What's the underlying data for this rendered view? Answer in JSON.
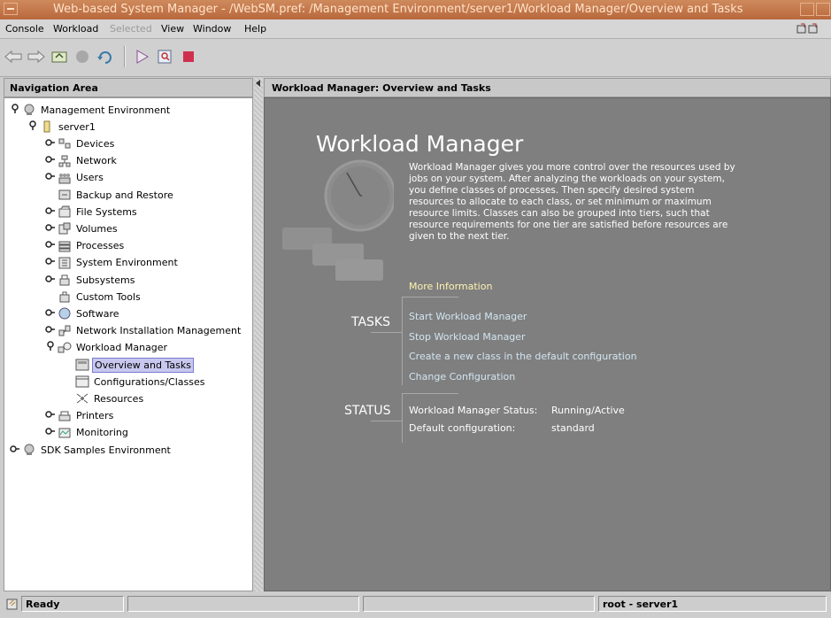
{
  "window": {
    "title": "Web-based System Manager - /WebSM.pref: /Management Environment/server1/Workload Manager/Overview and Tasks"
  },
  "menubar": {
    "console": "Console",
    "workload": "Workload",
    "selected": "Selected",
    "view": "View",
    "window": "Window",
    "help": "Help"
  },
  "toolbar": {
    "icons": [
      "back-arrow-icon",
      "forward-arrow-icon",
      "up-folder-icon",
      "stop-icon",
      "refresh-icon",
      "run-icon",
      "find-icon",
      "terminal-icon"
    ]
  },
  "navigation": {
    "header": "Navigation Area",
    "tree": [
      {
        "label": "Management Environment",
        "toggle": "open",
        "icon": "globe-icon"
      },
      {
        "label": "server1",
        "toggle": "open",
        "icon": "server-icon"
      },
      {
        "label": "Devices",
        "toggle": "closed",
        "icon": "devices-icon"
      },
      {
        "label": "Network",
        "toggle": "closed",
        "icon": "network-icon"
      },
      {
        "label": "Users",
        "toggle": "closed",
        "icon": "users-icon"
      },
      {
        "label": "Backup and Restore",
        "toggle": "",
        "icon": "backup-icon"
      },
      {
        "label": "File Systems",
        "toggle": "closed",
        "icon": "filesystem-icon"
      },
      {
        "label": "Volumes",
        "toggle": "closed",
        "icon": "volumes-icon"
      },
      {
        "label": "Processes",
        "toggle": "closed",
        "icon": "processes-icon"
      },
      {
        "label": "System Environment",
        "toggle": "closed",
        "icon": "system-env-icon"
      },
      {
        "label": "Subsystems",
        "toggle": "closed",
        "icon": "subsystems-icon"
      },
      {
        "label": "Custom Tools",
        "toggle": "",
        "icon": "custom-tools-icon"
      },
      {
        "label": "Software",
        "toggle": "closed",
        "icon": "software-icon"
      },
      {
        "label": "Network Installation Management",
        "toggle": "closed",
        "icon": "nim-icon"
      },
      {
        "label": "Workload Manager",
        "toggle": "open",
        "icon": "workload-icon"
      },
      {
        "label": "Overview and Tasks",
        "toggle": "",
        "icon": "overview-icon",
        "selected": true
      },
      {
        "label": "Configurations/Classes",
        "toggle": "",
        "icon": "configurations-icon"
      },
      {
        "label": "Resources",
        "toggle": "",
        "icon": "resources-icon"
      },
      {
        "label": "Printers",
        "toggle": "closed",
        "icon": "printer-icon"
      },
      {
        "label": "Monitoring",
        "toggle": "closed",
        "icon": "monitoring-icon"
      },
      {
        "label": "SDK Samples Environment",
        "toggle": "closed",
        "icon": "globe-icon"
      }
    ]
  },
  "content": {
    "header": "Workload Manager: Overview and Tasks",
    "title": "Workload Manager",
    "description": "Workload Manager gives you more control over the resources used by jobs on your system. After analyzing the workloads on your system, you define classes of processes. Then specify desired system resources to allocate to each class, or set minimum or maximum resource limits. Classes can also be grouped into tiers, such that resource requirements for one tier are satisfied before resources are given to the next tier.",
    "more_info": "More Information",
    "tasks_label": "TASKS",
    "tasks": [
      "Start Workload Manager",
      "Stop Workload Manager",
      "Create a new class in the default configuration",
      "Change Configuration"
    ],
    "status_label": "STATUS",
    "status": [
      {
        "key": "Workload Manager Status:",
        "value": "Running/Active"
      },
      {
        "key": "Default configuration:",
        "value": "standard"
      }
    ]
  },
  "statusbar": {
    "message": "Ready",
    "user": "root - server1"
  },
  "colors": {
    "titlebar": "#c47a4c",
    "content_bg": "#7f7f7f",
    "link": "#d2e6f2",
    "more_info": "#fff3b0",
    "selection": "#c8c8ef"
  }
}
